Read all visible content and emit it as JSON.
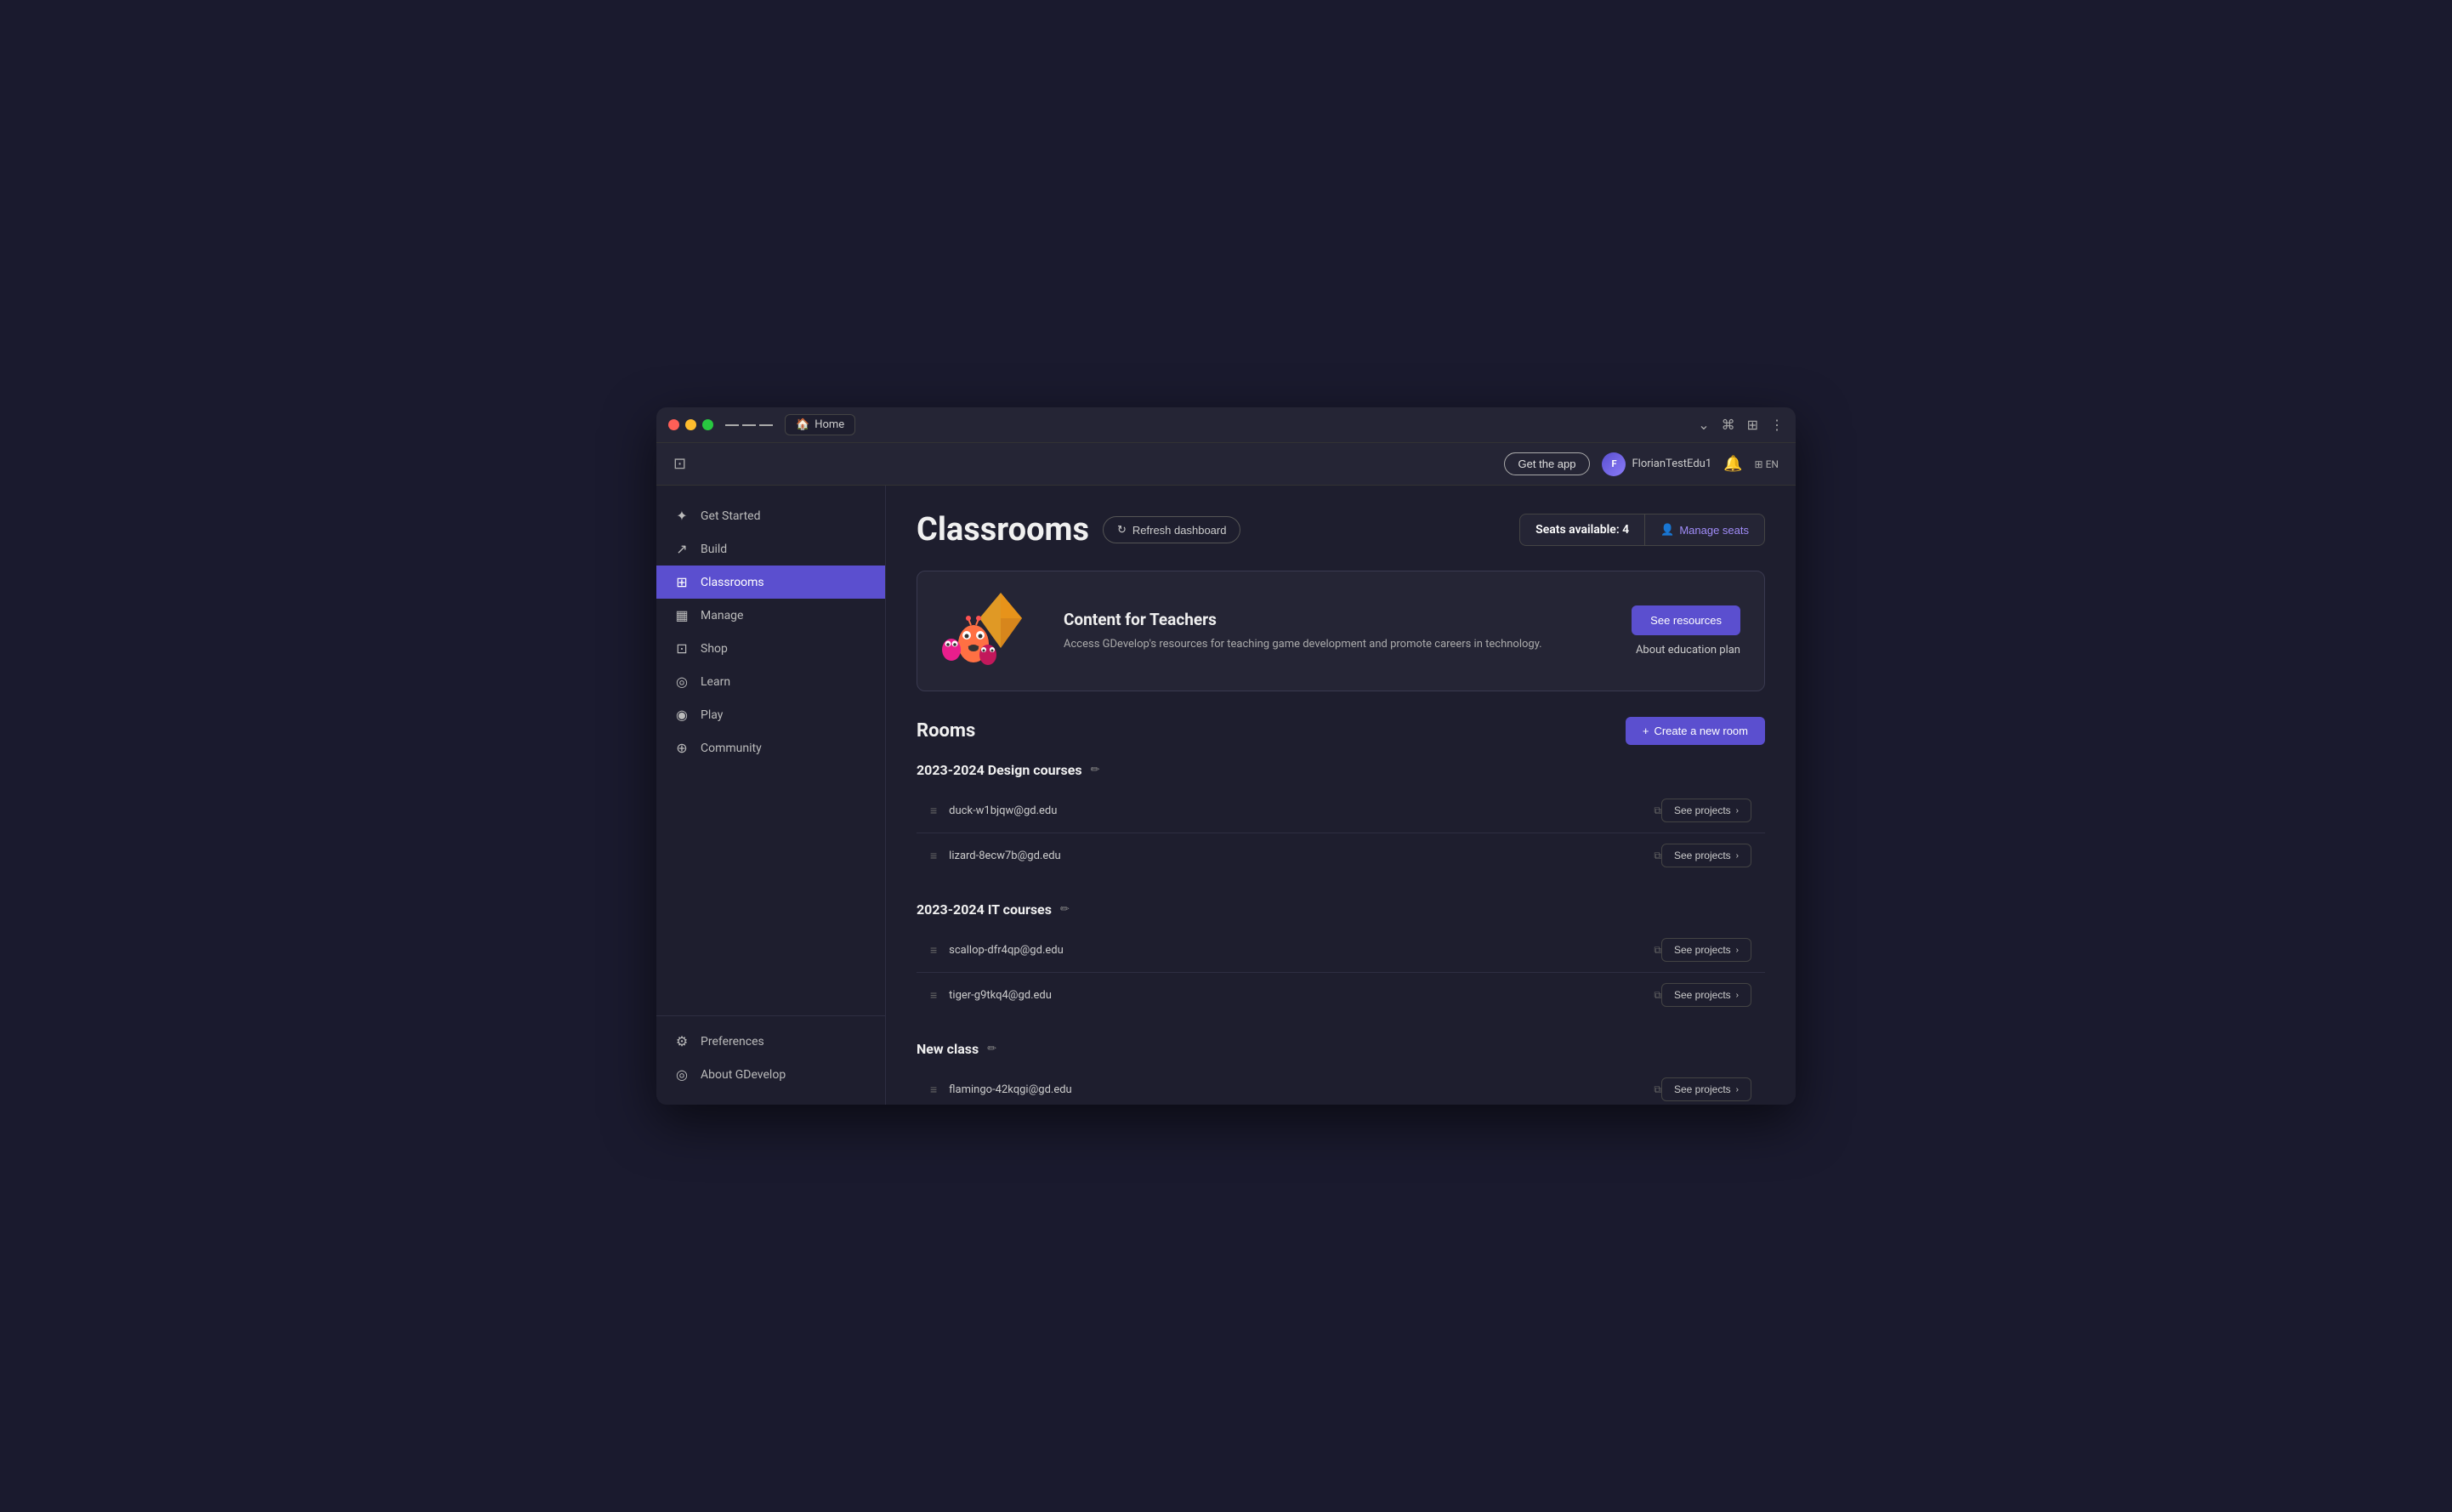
{
  "window": {
    "title": "Home"
  },
  "topbar": {
    "get_app_label": "Get the app",
    "user_name": "FlorianTestEdu1",
    "lang": "EN"
  },
  "sidebar": {
    "items": [
      {
        "label": "Get Started",
        "icon": "✦",
        "id": "get-started"
      },
      {
        "label": "Build",
        "icon": "⬆",
        "id": "build"
      },
      {
        "label": "Classrooms",
        "icon": "⊞",
        "id": "classrooms",
        "active": true
      },
      {
        "label": "Manage",
        "icon": "▦",
        "id": "manage"
      },
      {
        "label": "Shop",
        "icon": "⊡",
        "id": "shop"
      },
      {
        "label": "Learn",
        "icon": "◎",
        "id": "learn"
      },
      {
        "label": "Play",
        "icon": "◉",
        "id": "play"
      },
      {
        "label": "Community",
        "icon": "⊕",
        "id": "community"
      }
    ],
    "bottom_items": [
      {
        "label": "Preferences",
        "icon": "⚙",
        "id": "preferences"
      },
      {
        "label": "About GDevelop",
        "icon": "◎",
        "id": "about"
      }
    ]
  },
  "page": {
    "title": "Classrooms",
    "refresh_label": "Refresh dashboard",
    "seats_label": "Seats available:",
    "seats_count": "4",
    "manage_seats_label": "Manage seats"
  },
  "banner": {
    "title": "Content for Teachers",
    "description": "Access GDevelop's resources for teaching game development and promote careers in technology.",
    "see_resources_label": "See resources",
    "about_edu_label": "About education plan"
  },
  "rooms": {
    "title": "Rooms",
    "create_label": "Create a new room",
    "groups": [
      {
        "title": "2023-2024 Design courses",
        "id": "design-courses",
        "members": [
          {
            "email": "duck-w1bjqw@gd.edu"
          },
          {
            "email": "lizard-8ecw7b@gd.edu"
          }
        ]
      },
      {
        "title": "2023-2024 IT courses",
        "id": "it-courses",
        "members": [
          {
            "email": "scallop-dfr4qp@gd.edu"
          },
          {
            "email": "tiger-g9tkq4@gd.edu"
          }
        ]
      },
      {
        "title": "New class",
        "id": "new-class",
        "members": [
          {
            "email": "flamingo-42kqgi@gd.edu"
          }
        ]
      }
    ],
    "see_projects_label": "See projects"
  },
  "colors": {
    "accent": "#5b4fcf",
    "active_bg": "#5b4fcf"
  }
}
